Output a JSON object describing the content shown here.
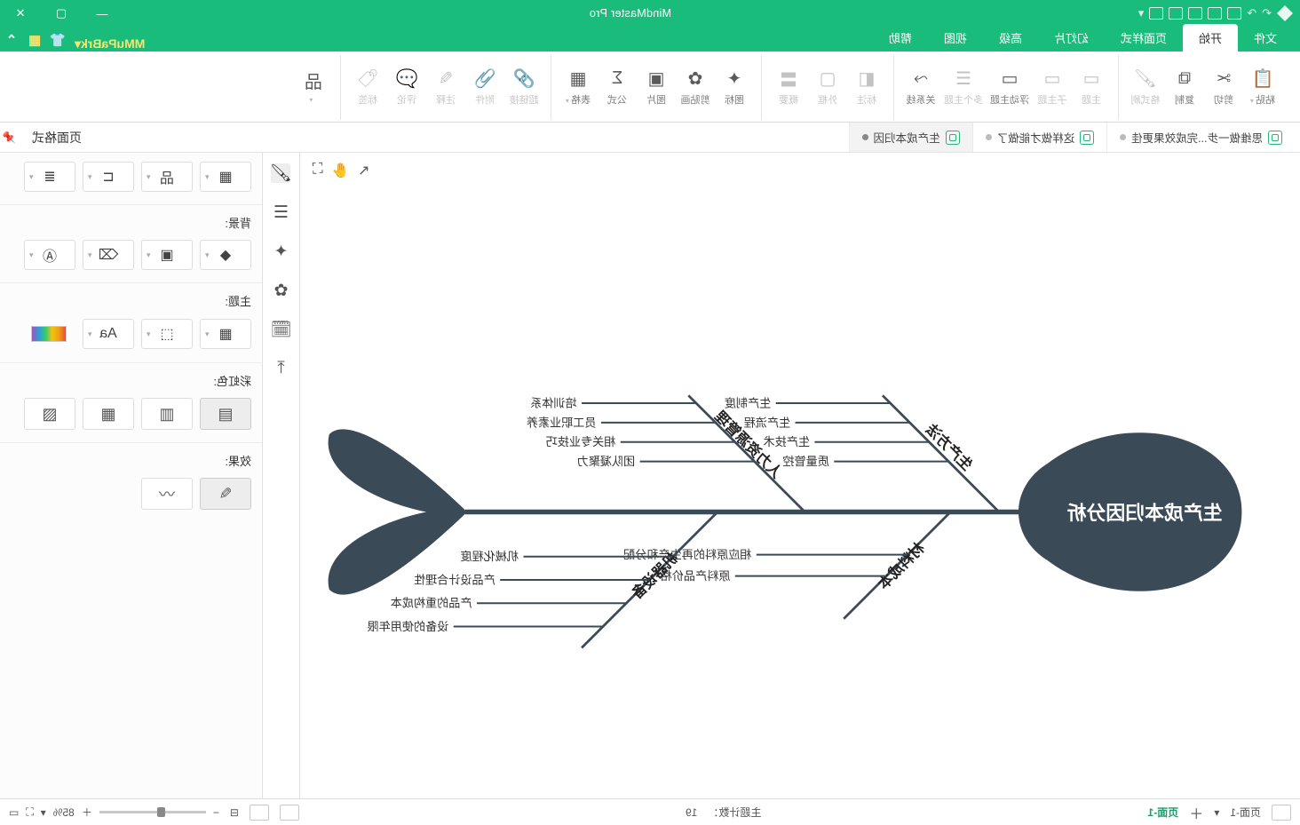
{
  "app_title": "MindMaster Pro",
  "brand_suffix": "MMuPaBrk▾",
  "menu": {
    "file": "文件",
    "start": "开始",
    "page_style": "页面样式",
    "slideshow": "幻灯片",
    "advanced": "高级",
    "view": "视图",
    "help": "帮助"
  },
  "ribbon": {
    "paste": "粘贴",
    "cut": "剪切",
    "copy": "复制",
    "format_painter": "格式刷",
    "topic": "主题",
    "subtopic": "子主题",
    "floating": "浮动主题",
    "multi": "多个主题",
    "relation": "关系线",
    "annotate": "标注",
    "outline": "外框",
    "summary": "概要",
    "icon": "图标",
    "clipart": "剪贴画",
    "picture": "图片",
    "formula": "公式",
    "table": "表格",
    "hyperlink": "超链接",
    "attachment": "附件",
    "note": "注释",
    "comment": "评论",
    "tag": "标签",
    "layout_btn": "品"
  },
  "doctabs": {
    "t1": "思维做一步...完成效果更佳",
    "t2": "这样做才能做了",
    "t3": "生产成本归因"
  },
  "panel_title": "页面格式",
  "panel": {
    "bg": "背景:",
    "theme": "主题:",
    "color": "彩虹色:",
    "effect": "效果:"
  },
  "status": {
    "page_label": "页面-1",
    "count_label": "主题计数：",
    "count": "19",
    "zoom": "85%",
    "pg_current": "页面-1"
  },
  "fish": {
    "head": "生产成本归因分析",
    "bones": {
      "b1": {
        "label": "生产方法",
        "items": [
          "生产制度",
          "生产流程",
          "生产技术",
          "质量管控"
        ]
      },
      "b2": {
        "label": "人力资源管理",
        "items": [
          "培训体系",
          "员工职业素养",
          "相关专业技巧",
          "团队凝聚力"
        ]
      },
      "b3": {
        "label": "材料成本",
        "items": [
          "相应原料的再生产和分配",
          "原料产品价格"
        ]
      },
      "b4": {
        "label": "机器设备",
        "items": [
          "机械化程度",
          "产品设计合理性",
          "产品的重构成本",
          "设备的使用年限"
        ]
      }
    }
  }
}
